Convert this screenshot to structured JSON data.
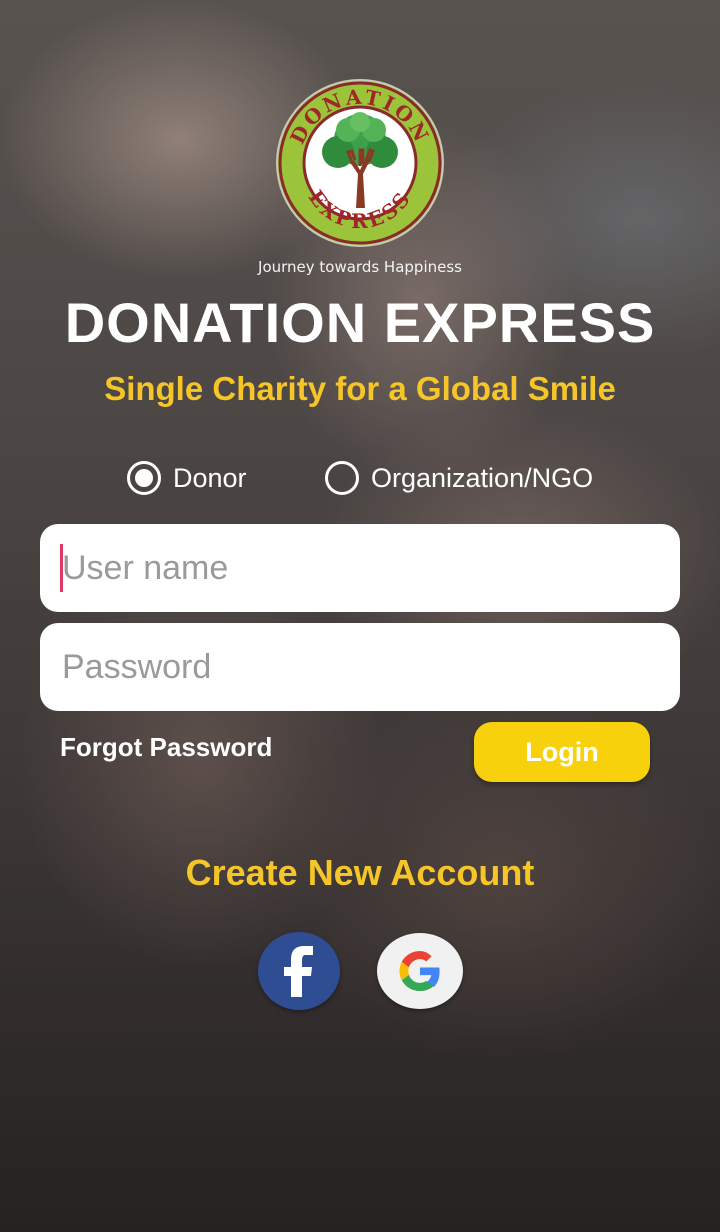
{
  "brand": {
    "logo_top_text": "DONATION",
    "logo_bottom_text": "EXPRESS",
    "tagline": "Journey towards Happiness",
    "title": "DONATION EXPRESS",
    "subtitle": "Single Charity for a Global Smile"
  },
  "account_type": {
    "options": [
      {
        "label": "Donor",
        "selected": true
      },
      {
        "label": "Organization/NGO",
        "selected": false
      }
    ]
  },
  "form": {
    "username_placeholder": "User name",
    "username_value": "",
    "password_placeholder": "Password",
    "password_value": ""
  },
  "actions": {
    "forgot_password": "Forgot Password",
    "login": "Login",
    "create_account": "Create New Account"
  },
  "social": {
    "facebook_icon": "facebook-icon",
    "google_icon": "google-icon"
  },
  "colors": {
    "accent_yellow": "#f6c629",
    "login_button": "#f8d10d",
    "facebook_blue": "#2f4d93"
  }
}
